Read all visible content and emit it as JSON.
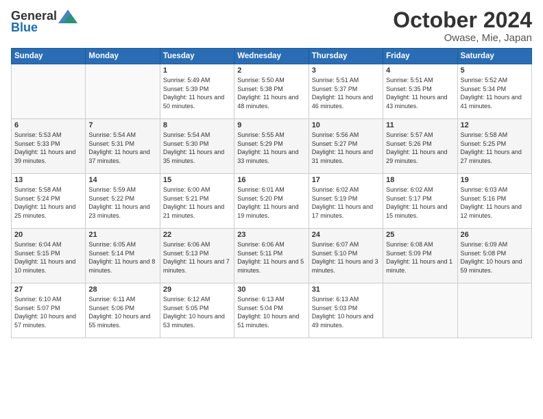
{
  "header": {
    "logo_general": "General",
    "logo_blue": "Blue",
    "month": "October 2024",
    "location": "Owase, Mie, Japan"
  },
  "weekdays": [
    "Sunday",
    "Monday",
    "Tuesday",
    "Wednesday",
    "Thursday",
    "Friday",
    "Saturday"
  ],
  "weeks": [
    [
      {
        "day": "",
        "sunrise": "",
        "sunset": "",
        "daylight": ""
      },
      {
        "day": "",
        "sunrise": "",
        "sunset": "",
        "daylight": ""
      },
      {
        "day": "1",
        "sunrise": "Sunrise: 5:49 AM",
        "sunset": "Sunset: 5:39 PM",
        "daylight": "Daylight: 11 hours and 50 minutes."
      },
      {
        "day": "2",
        "sunrise": "Sunrise: 5:50 AM",
        "sunset": "Sunset: 5:38 PM",
        "daylight": "Daylight: 11 hours and 48 minutes."
      },
      {
        "day": "3",
        "sunrise": "Sunrise: 5:51 AM",
        "sunset": "Sunset: 5:37 PM",
        "daylight": "Daylight: 11 hours and 46 minutes."
      },
      {
        "day": "4",
        "sunrise": "Sunrise: 5:51 AM",
        "sunset": "Sunset: 5:35 PM",
        "daylight": "Daylight: 11 hours and 43 minutes."
      },
      {
        "day": "5",
        "sunrise": "Sunrise: 5:52 AM",
        "sunset": "Sunset: 5:34 PM",
        "daylight": "Daylight: 11 hours and 41 minutes."
      }
    ],
    [
      {
        "day": "6",
        "sunrise": "Sunrise: 5:53 AM",
        "sunset": "Sunset: 5:33 PM",
        "daylight": "Daylight: 11 hours and 39 minutes."
      },
      {
        "day": "7",
        "sunrise": "Sunrise: 5:54 AM",
        "sunset": "Sunset: 5:31 PM",
        "daylight": "Daylight: 11 hours and 37 minutes."
      },
      {
        "day": "8",
        "sunrise": "Sunrise: 5:54 AM",
        "sunset": "Sunset: 5:30 PM",
        "daylight": "Daylight: 11 hours and 35 minutes."
      },
      {
        "day": "9",
        "sunrise": "Sunrise: 5:55 AM",
        "sunset": "Sunset: 5:29 PM",
        "daylight": "Daylight: 11 hours and 33 minutes."
      },
      {
        "day": "10",
        "sunrise": "Sunrise: 5:56 AM",
        "sunset": "Sunset: 5:27 PM",
        "daylight": "Daylight: 11 hours and 31 minutes."
      },
      {
        "day": "11",
        "sunrise": "Sunrise: 5:57 AM",
        "sunset": "Sunset: 5:26 PM",
        "daylight": "Daylight: 11 hours and 29 minutes."
      },
      {
        "day": "12",
        "sunrise": "Sunrise: 5:58 AM",
        "sunset": "Sunset: 5:25 PM",
        "daylight": "Daylight: 11 hours and 27 minutes."
      }
    ],
    [
      {
        "day": "13",
        "sunrise": "Sunrise: 5:58 AM",
        "sunset": "Sunset: 5:24 PM",
        "daylight": "Daylight: 11 hours and 25 minutes."
      },
      {
        "day": "14",
        "sunrise": "Sunrise: 5:59 AM",
        "sunset": "Sunset: 5:22 PM",
        "daylight": "Daylight: 11 hours and 23 minutes."
      },
      {
        "day": "15",
        "sunrise": "Sunrise: 6:00 AM",
        "sunset": "Sunset: 5:21 PM",
        "daylight": "Daylight: 11 hours and 21 minutes."
      },
      {
        "day": "16",
        "sunrise": "Sunrise: 6:01 AM",
        "sunset": "Sunset: 5:20 PM",
        "daylight": "Daylight: 11 hours and 19 minutes."
      },
      {
        "day": "17",
        "sunrise": "Sunrise: 6:02 AM",
        "sunset": "Sunset: 5:19 PM",
        "daylight": "Daylight: 11 hours and 17 minutes."
      },
      {
        "day": "18",
        "sunrise": "Sunrise: 6:02 AM",
        "sunset": "Sunset: 5:17 PM",
        "daylight": "Daylight: 11 hours and 15 minutes."
      },
      {
        "day": "19",
        "sunrise": "Sunrise: 6:03 AM",
        "sunset": "Sunset: 5:16 PM",
        "daylight": "Daylight: 11 hours and 12 minutes."
      }
    ],
    [
      {
        "day": "20",
        "sunrise": "Sunrise: 6:04 AM",
        "sunset": "Sunset: 5:15 PM",
        "daylight": "Daylight: 11 hours and 10 minutes."
      },
      {
        "day": "21",
        "sunrise": "Sunrise: 6:05 AM",
        "sunset": "Sunset: 5:14 PM",
        "daylight": "Daylight: 11 hours and 8 minutes."
      },
      {
        "day": "22",
        "sunrise": "Sunrise: 6:06 AM",
        "sunset": "Sunset: 5:13 PM",
        "daylight": "Daylight: 11 hours and 7 minutes."
      },
      {
        "day": "23",
        "sunrise": "Sunrise: 6:06 AM",
        "sunset": "Sunset: 5:11 PM",
        "daylight": "Daylight: 11 hours and 5 minutes."
      },
      {
        "day": "24",
        "sunrise": "Sunrise: 6:07 AM",
        "sunset": "Sunset: 5:10 PM",
        "daylight": "Daylight: 11 hours and 3 minutes."
      },
      {
        "day": "25",
        "sunrise": "Sunrise: 6:08 AM",
        "sunset": "Sunset: 5:09 PM",
        "daylight": "Daylight: 11 hours and 1 minute."
      },
      {
        "day": "26",
        "sunrise": "Sunrise: 6:09 AM",
        "sunset": "Sunset: 5:08 PM",
        "daylight": "Daylight: 10 hours and 59 minutes."
      }
    ],
    [
      {
        "day": "27",
        "sunrise": "Sunrise: 6:10 AM",
        "sunset": "Sunset: 5:07 PM",
        "daylight": "Daylight: 10 hours and 57 minutes."
      },
      {
        "day": "28",
        "sunrise": "Sunrise: 6:11 AM",
        "sunset": "Sunset: 5:06 PM",
        "daylight": "Daylight: 10 hours and 55 minutes."
      },
      {
        "day": "29",
        "sunrise": "Sunrise: 6:12 AM",
        "sunset": "Sunset: 5:05 PM",
        "daylight": "Daylight: 10 hours and 53 minutes."
      },
      {
        "day": "30",
        "sunrise": "Sunrise: 6:13 AM",
        "sunset": "Sunset: 5:04 PM",
        "daylight": "Daylight: 10 hours and 51 minutes."
      },
      {
        "day": "31",
        "sunrise": "Sunrise: 6:13 AM",
        "sunset": "Sunset: 5:03 PM",
        "daylight": "Daylight: 10 hours and 49 minutes."
      },
      {
        "day": "",
        "sunrise": "",
        "sunset": "",
        "daylight": ""
      },
      {
        "day": "",
        "sunrise": "",
        "sunset": "",
        "daylight": ""
      }
    ]
  ]
}
